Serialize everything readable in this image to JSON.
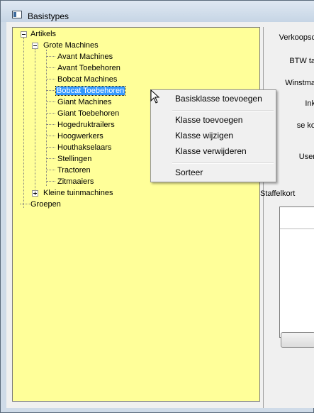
{
  "window": {
    "title": "Basistypes"
  },
  "tree": {
    "root": "Artikels",
    "group": "Grote Machines",
    "children": [
      "Avant Machines",
      "Avant Toebehoren",
      "Bobcat Machines",
      "Bobcat Toebehoren",
      "Giant Machines",
      "Giant Toebehoren",
      "Hogedruktrailers",
      "Hoogwerkers",
      "Houthakselaars",
      "Stellingen",
      "Tractoren",
      "Zitmaaiers"
    ],
    "selected": "Bobcat Toebehoren",
    "collapsed_group": "Kleine tuinmachines",
    "second_root": "Groepen",
    "background_color": "#ffff99",
    "selection_color": "#3399ff"
  },
  "right_panel": {
    "labels": [
      "Verkoopsc",
      "BTW ta",
      "Winstma",
      "Ink",
      "se ko",
      "User",
      "Staffelkort"
    ]
  },
  "context_menu": {
    "items": [
      "Basisklasse toevoegen",
      "Klasse toevoegen",
      "Klasse wijzigen",
      "Klasse verwijderen",
      "Sorteer"
    ]
  }
}
